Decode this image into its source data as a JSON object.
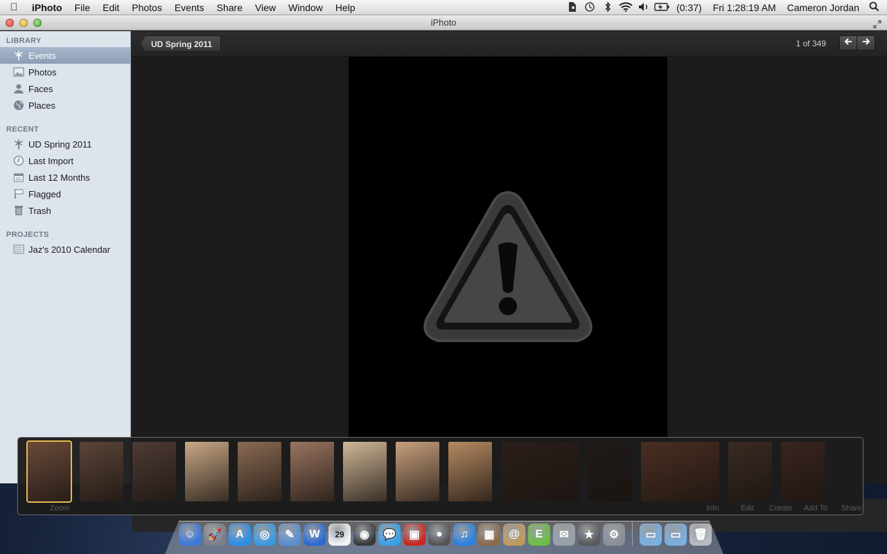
{
  "menubar": {
    "apple_icon": "apple-icon",
    "app_name": "iPhoto",
    "items": [
      "File",
      "Edit",
      "Photos",
      "Events",
      "Share",
      "View",
      "Window",
      "Help"
    ],
    "status_icons": [
      "evernote-icon",
      "time-machine-icon",
      "bluetooth-icon",
      "wifi-icon",
      "volume-icon",
      "battery-icon"
    ],
    "battery": "(0:37)",
    "clock": "Fri 1:28:19 AM",
    "user": "Cameron Jordan",
    "spotlight_icon": "spotlight-icon"
  },
  "window": {
    "title": "iPhoto"
  },
  "sidebar": {
    "library_header": "LIBRARY",
    "library": [
      {
        "label": "Events",
        "icon": "palm-tree-icon",
        "selected": true
      },
      {
        "label": "Photos",
        "icon": "photo-icon"
      },
      {
        "label": "Faces",
        "icon": "person-icon"
      },
      {
        "label": "Places",
        "icon": "globe-icon"
      }
    ],
    "recent_header": "RECENT",
    "recent": [
      {
        "label": "UD Spring 2011",
        "icon": "palm-tree-icon"
      },
      {
        "label": "Last Import",
        "icon": "clock-icon"
      },
      {
        "label": "Last 12 Months",
        "icon": "calendar-icon"
      },
      {
        "label": "Flagged",
        "icon": "flag-icon"
      },
      {
        "label": "Trash",
        "icon": "trash-icon"
      }
    ],
    "projects_header": "PROJECTS",
    "projects": [
      {
        "label": "Jaz's 2010 Calendar",
        "icon": "calendar-project-icon"
      }
    ]
  },
  "viewer": {
    "breadcrumb": "UD Spring 2011",
    "counter": "1 of 349",
    "prev_icon": "arrow-left-icon",
    "next_icon": "arrow-right-icon",
    "placeholder_icon": "warning-icon"
  },
  "filmstrip": {
    "thumbs": [
      {
        "color": "#6a4a3a",
        "selected": true
      },
      {
        "color": "#5a4438"
      },
      {
        "color": "#4e3a34"
      },
      {
        "color": "#c9a886"
      },
      {
        "color": "#8a6a52"
      },
      {
        "color": "#9a7460"
      },
      {
        "color": "#d0b898"
      },
      {
        "color": "#c8a07e"
      },
      {
        "color": "#b68a62"
      },
      {
        "color": "#2a1e1a"
      },
      {
        "color": "#1e1a18"
      },
      {
        "color": "#4a2e22"
      },
      {
        "color": "#3a2a22"
      },
      {
        "color": "#3a2420"
      }
    ],
    "ghost_labels": {
      "zoom": "Zoom",
      "info": "Info",
      "edit": "Edit",
      "create": "Create",
      "add_to": "Add To",
      "share": "Share"
    }
  },
  "dock": {
    "apps": [
      {
        "name": "finder-icon",
        "color": "#3a78d8",
        "glyph": "☺"
      },
      {
        "name": "launchpad-icon",
        "color": "#7a7f88",
        "glyph": "🚀"
      },
      {
        "name": "app-store-icon",
        "color": "#2a8ee8",
        "glyph": "A"
      },
      {
        "name": "safari-icon",
        "color": "#3a9ae0",
        "glyph": "◎"
      },
      {
        "name": "preview-icon",
        "color": "#5b8ed0",
        "glyph": "✎"
      },
      {
        "name": "word-icon",
        "color": "#2a6ad0",
        "glyph": "W"
      },
      {
        "name": "calendar-icon",
        "color": "#f2f2f2",
        "glyph": "29"
      },
      {
        "name": "dashboard-icon",
        "color": "#3a3a3a",
        "glyph": "◉"
      },
      {
        "name": "messages-icon",
        "color": "#3aa0e8",
        "glyph": "💬"
      },
      {
        "name": "photo-booth-icon",
        "color": "#c8281e",
        "glyph": "▣"
      },
      {
        "name": "facetime-icon",
        "color": "#555555",
        "glyph": "●"
      },
      {
        "name": "itunes-icon",
        "color": "#2a80e0",
        "glyph": "♫"
      },
      {
        "name": "iphoto-icon",
        "color": "#8a6a4a",
        "glyph": "▦"
      },
      {
        "name": "address-book-icon",
        "color": "#c09a5a",
        "glyph": "@"
      },
      {
        "name": "evernote-icon",
        "color": "#6abf40",
        "glyph": "E"
      },
      {
        "name": "image-capture-icon",
        "color": "#9aa0a8",
        "glyph": "✉"
      },
      {
        "name": "imovie-icon",
        "color": "#5a5a5a",
        "glyph": "★"
      },
      {
        "name": "system-preferences-icon",
        "color": "#8a8f96",
        "glyph": "⚙"
      },
      {
        "name": "applications-folder-icon",
        "color": "#7ab0e0",
        "glyph": "▭"
      },
      {
        "name": "documents-folder-icon",
        "color": "#7ab0e0",
        "glyph": "▭"
      },
      {
        "name": "trash-icon",
        "color": "#b8bcc2",
        "glyph": "🗑"
      }
    ]
  }
}
